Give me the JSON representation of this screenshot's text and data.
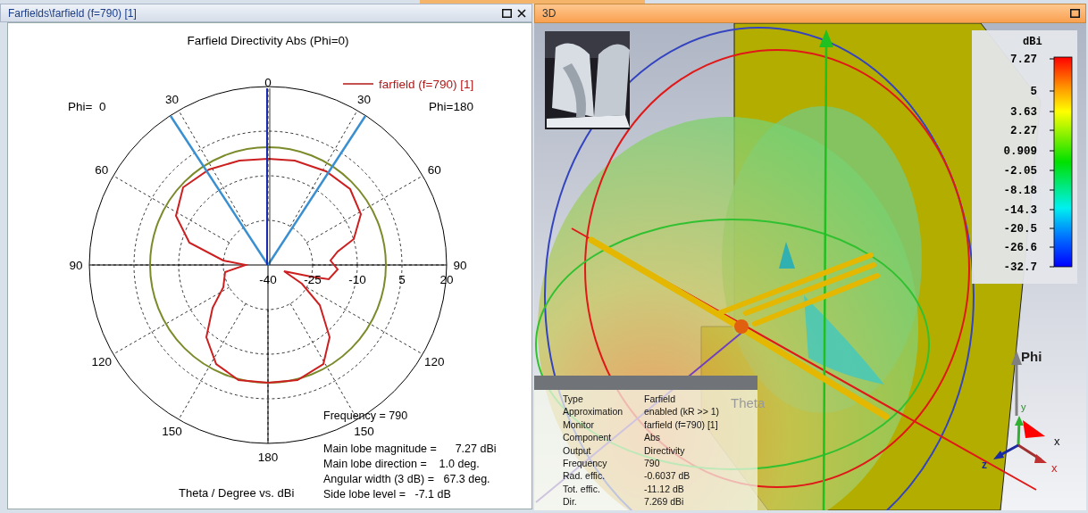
{
  "left_panel": {
    "title": "Farfields\\farfield (f=790) [1]",
    "plot": {
      "title": "Farfield Directivity Abs (Phi=0)",
      "legend_label": "farfield (f=790) [1]",
      "phi_left": "Phi=  0",
      "phi_right": "Phi=180",
      "angle_labels": [
        "0",
        "30",
        "60",
        "90",
        "120",
        "150",
        "180",
        "150",
        "120",
        "90",
        "60",
        "30"
      ],
      "radial_labels": [
        "-40",
        "-25",
        "-10",
        "5",
        "20"
      ],
      "results": [
        "Frequency = 790",
        "Main lobe magnitude =      7.27 dBi",
        "Main lobe direction =    1.0 deg.",
        "Angular width (3 dB) =   67.3 deg.",
        "Side lobe level =   -7.1 dB"
      ],
      "axis_label": "Theta / Degree vs. dBi"
    }
  },
  "right_panel": {
    "title": "3D",
    "legend": {
      "unit": "dBi",
      "ticks": [
        "7.27",
        "5",
        "3.63",
        "2.27",
        "0.909",
        "-2.05",
        "-8.18",
        "-14.3",
        "-20.5",
        "-26.6",
        "-32.7"
      ]
    },
    "axis_labels": [
      {
        "text": "Phi",
        "kind": "phi"
      },
      {
        "text": "Theta",
        "kind": "theta"
      },
      {
        "text": "x",
        "kind": "beam-x"
      },
      {
        "text": "y",
        "kind": "triad-y"
      },
      {
        "text": "z",
        "kind": "triad-z"
      },
      {
        "text": "x",
        "kind": "triad-x"
      }
    ],
    "info": [
      {
        "label": "Type",
        "value": "Farfield"
      },
      {
        "label": "Approximation",
        "value": "enabled (kR >> 1)"
      },
      {
        "label": "Monitor",
        "value": "farfield (f=790) [1]"
      },
      {
        "label": "Component",
        "value": "Abs"
      },
      {
        "label": "Output",
        "value": "Directivity"
      },
      {
        "label": "Frequency",
        "value": "790"
      },
      {
        "label": "Rad. effic.",
        "value": "-0.6037 dB"
      },
      {
        "label": "Tot. effic.",
        "value": "-11.12 dB"
      },
      {
        "label": "Dir.",
        "value": "7.269 dBi"
      }
    ]
  }
}
